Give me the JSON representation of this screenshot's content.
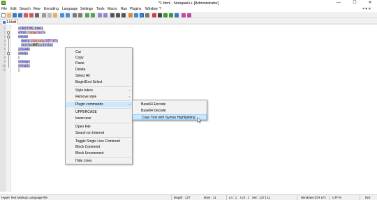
{
  "window": {
    "title": "*1.html - Notepad++ [Administrator]",
    "minimize_glyph": "—",
    "maximize_glyph": "☐",
    "close_glyph": "✕"
  },
  "menu": [
    "File",
    "Edit",
    "Search",
    "View",
    "Encoding",
    "Language",
    "Settings",
    "Tools",
    "Macro",
    "Run",
    "Plugins",
    "Window",
    "?"
  ],
  "menu_extra": "+ ▾ ✕",
  "tab": {
    "label": "1.html",
    "close_glyph": "✕"
  },
  "line_numbers": [
    "1",
    "2",
    "3",
    "4",
    "5",
    "6",
    "7",
    "8",
    "9",
    "10",
    "11"
  ],
  "code": {
    "l1": "<!DOCTYPE html>",
    "l2_open": "<html ",
    "l2_attr": "lang",
    "l2_eq": "=",
    "l2_val": "\"en\"",
    "l2_close": ">",
    "l3": "<head>",
    "l4_open": "<meta ",
    "l4_attr": "charset",
    "l4_eq": "=",
    "l4_val": "\"UTF-8\"",
    "l4_close": ">",
    "l5_open": "<title>",
    "l5_text": "HMTL",
    "l5_close": "</title>",
    "l6": "</head>",
    "l7": "<body>",
    "l9": "</body>",
    "l10": "</html>"
  },
  "context_menu": {
    "cut": "Cut",
    "copy": "Copy",
    "paste": "Paste",
    "delete": "Delete",
    "select_all": "Select All",
    "begin_end_select": "Begin/End Select",
    "style_token": "Style token",
    "remove_style": "Remove style",
    "plugin_commands": "Plugin commands",
    "uppercase": "UPPERCASE",
    "lowercase": "lowercase",
    "open_file": "Open File",
    "search_internet": "Search on Internet",
    "toggle_comment": "Toggle Single Line Comment",
    "block_comment": "Block Comment",
    "block_uncomment": "Block Uncomment",
    "hide_lines": "Hide Lines",
    "arrow": "›"
  },
  "submenu": {
    "base64_encode": "Base64 Encode",
    "base64_decode": "Base64 Decode",
    "copy_text_syntax": "Copy Text with Syntax Highlighting"
  },
  "status": {
    "language": "Hyper Text Markup Language file",
    "length": "length : 127",
    "lines": "lines : 11",
    "ln": "Ln : 1",
    "col": "Col : 1",
    "sel": "Sel : 127 | 11",
    "eol": "Windows (CR LF)",
    "encoding": "UTF-8",
    "mode": "INS"
  },
  "colors": {
    "tag": "#0000ff",
    "attribute": "#ff0000",
    "string": "#8000ff",
    "selection": "#c0c0c0",
    "menu_highlight": "#cce8ff"
  }
}
